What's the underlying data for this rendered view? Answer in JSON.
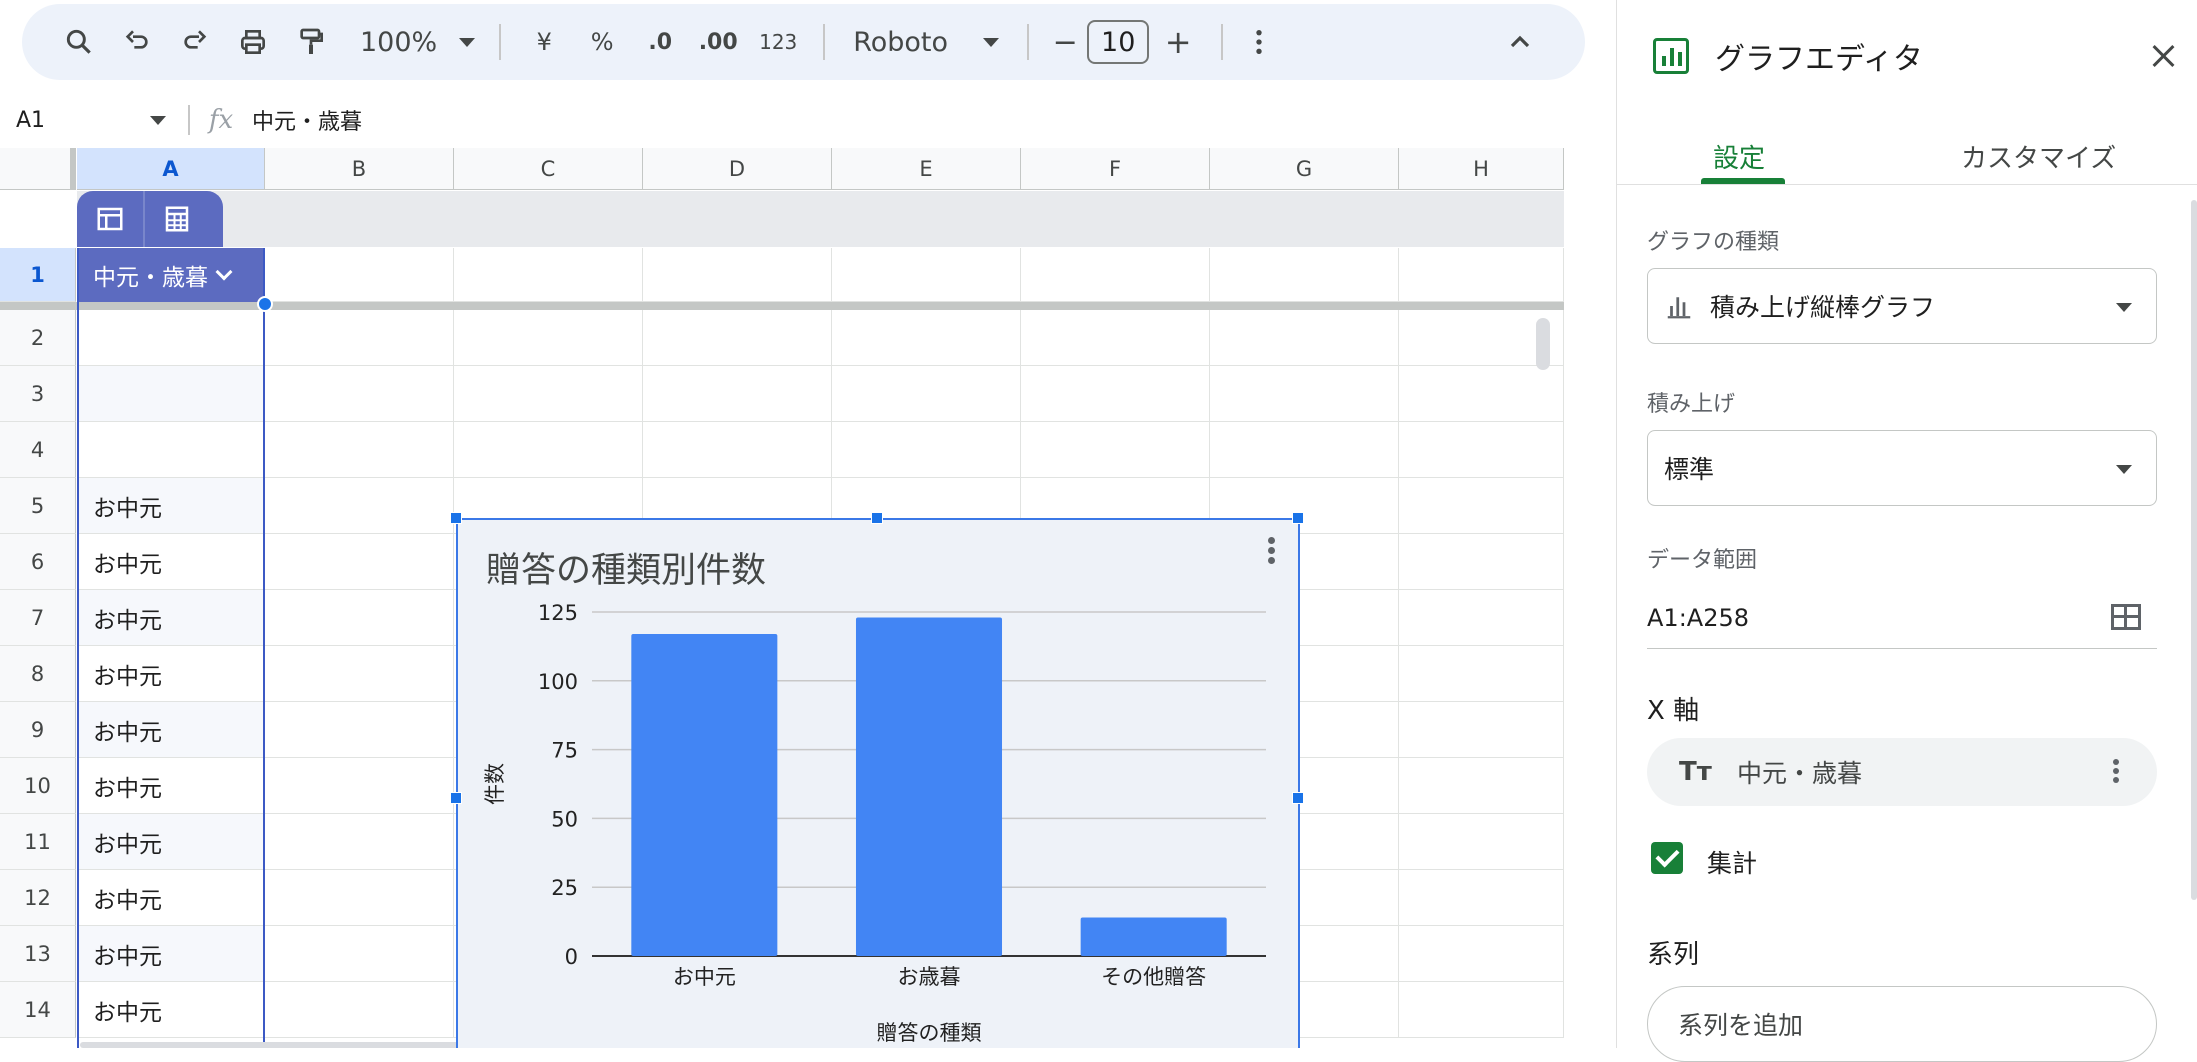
{
  "toolbar": {
    "zoom": "100%",
    "currency_symbol": "¥",
    "percent_symbol": "%",
    "decrease_decimal": ".0",
    "increase_decimal": ".00",
    "number_format": "123",
    "font_name": "Roboto",
    "font_size": "10",
    "minus": "−",
    "plus": "+"
  },
  "formula_bar": {
    "cell_ref": "A1",
    "fx": "fx",
    "value": "中元・歳暮"
  },
  "grid": {
    "columns": [
      "A",
      "B",
      "C",
      "D",
      "E",
      "F",
      "G",
      "H"
    ],
    "rows": [
      "1",
      "2",
      "3",
      "4",
      "5",
      "6",
      "7",
      "8",
      "9",
      "10",
      "11",
      "12",
      "13",
      "14"
    ],
    "header_cell": "中元・歳暮",
    "col_a_values": [
      "",
      "",
      "",
      "お中元",
      "お中元",
      "お中元",
      "お中元",
      "お中元",
      "お中元",
      "お中元",
      "お中元",
      "お中元",
      "お中元"
    ]
  },
  "chart_data": {
    "type": "bar",
    "title": "贈答の種類別件数",
    "xlabel": "贈答の種類",
    "ylabel": "件数",
    "categories": [
      "お中元",
      "お歳暮",
      "その他贈答"
    ],
    "values": [
      117,
      123,
      14
    ],
    "ylim": [
      0,
      125
    ],
    "yticks": [
      "0",
      "25",
      "50",
      "75",
      "100",
      "125"
    ],
    "grid": true,
    "color": "#4285f4"
  },
  "panel": {
    "title": "グラフエディタ",
    "tabs": {
      "setup": "設定",
      "customize": "カスタマイズ"
    },
    "chart_type_label": "グラフの種類",
    "chart_type_value": "積み上げ縦棒グラフ",
    "stacking_label": "積み上げ",
    "stacking_value": "標準",
    "range_label": "データ範囲",
    "range_value": "A1:A258",
    "xaxis_heading": "X 軸",
    "xaxis_type_icon": "Tт",
    "xaxis_value": "中元・歳暮",
    "aggregate_label": "集計",
    "series_heading": "系列",
    "add_series": "系列を追加",
    "accent_color": "#188038"
  }
}
